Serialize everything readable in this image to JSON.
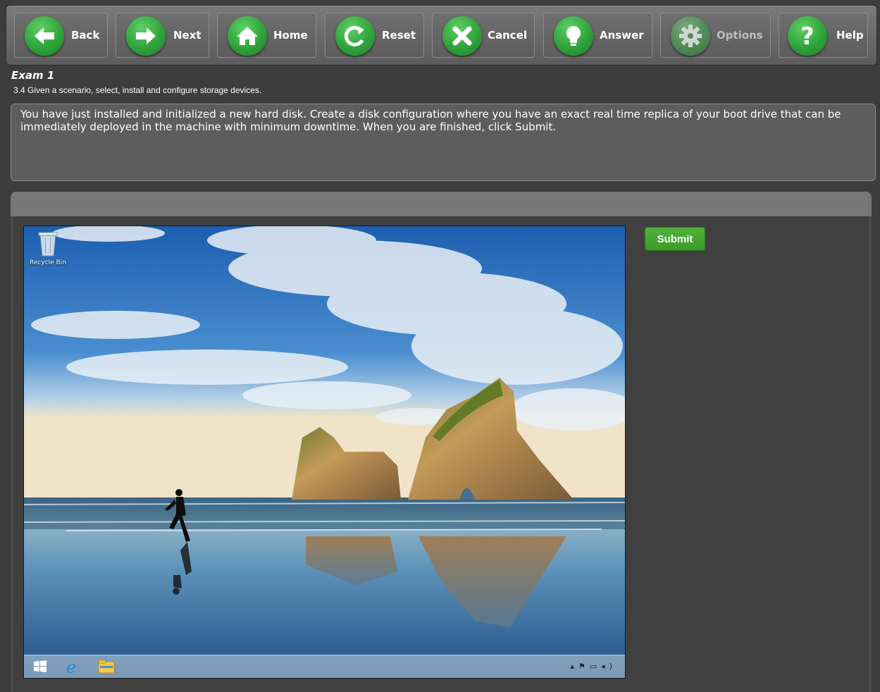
{
  "toolbar": {
    "buttons": [
      {
        "label": "Back",
        "icon": "arrow-left-icon"
      },
      {
        "label": "Next",
        "icon": "arrow-right-icon"
      },
      {
        "label": "Home",
        "icon": "home-icon"
      },
      {
        "label": "Reset",
        "icon": "reset-icon"
      },
      {
        "label": "Cancel",
        "icon": "close-icon"
      },
      {
        "label": "Answer",
        "icon": "lightbulb-icon"
      },
      {
        "label": "Options",
        "icon": "gear-icon",
        "disabled": true
      },
      {
        "label": "Help",
        "icon": "question-icon"
      }
    ]
  },
  "exam": {
    "title": "Exam 1",
    "objective": "3.4 Given a scenario, select, install and configure storage devices.",
    "question": "You have just installed and initialized a new hard disk. Create a disk configuration where you have an exact real time replica of your boot drive that can be immediately deployed in the machine with minimum downtime. When you are finished, click Submit."
  },
  "desktop": {
    "recycle_bin_label": "Recycle Bin",
    "taskbar_icons": [
      "windows-start-icon",
      "internet-explorer-icon",
      "file-explorer-icon"
    ],
    "tray_icons": [
      "tray-arrow-icon",
      "flag-icon",
      "network-icon",
      "volume-icon"
    ]
  },
  "actions": {
    "submit_label": "Submit"
  },
  "colors": {
    "button_green": "#2fa33a",
    "submit_green": "#3a9a27",
    "background": "#3d3d3d"
  }
}
